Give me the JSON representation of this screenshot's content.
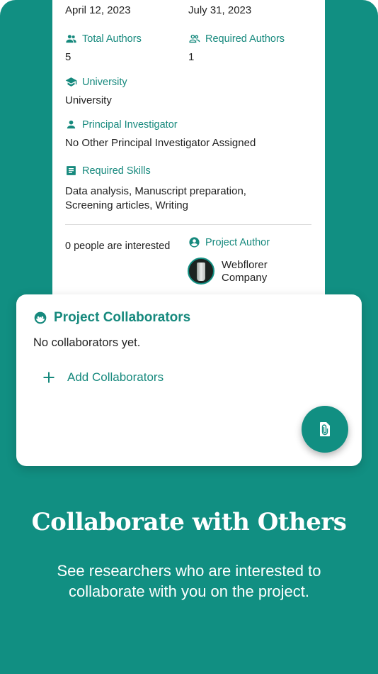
{
  "details": {
    "start_date": "April 12, 2023",
    "end_date": "July 31, 2023",
    "total_authors_label": "Total Authors",
    "total_authors_value": "5",
    "required_authors_label": "Required Authors",
    "required_authors_value": "1",
    "university_label": "University",
    "university_value": "University",
    "pi_label": "Principal Investigator",
    "pi_value": "No Other Principal Investigator Assigned",
    "skills_label": "Required Skills",
    "skills_value": "Data analysis, Manuscript preparation, Screening articles, Writing",
    "interested_text": "0 people are interested",
    "project_author_label": "Project Author",
    "author_name_line1": "Webflorer",
    "author_name_line2": "Company"
  },
  "collaborators": {
    "title": "Project Collaborators",
    "empty_text": "No collaborators yet.",
    "add_label": "Add Collaborators"
  },
  "promo": {
    "headline": "Collaborate with Others",
    "subtext": "See researchers who are interested to collaborate with you on the project."
  },
  "colors": {
    "accent": "#118f82",
    "label": "#16897d"
  },
  "icons": {
    "total_authors": "people-icon",
    "required_authors": "people-outline-icon",
    "university": "graduation-cap-icon",
    "principal_investigator": "person-icon",
    "required_skills": "list-icon",
    "project_author": "account-circle-icon",
    "collaborators": "face-icon",
    "add": "plus-icon",
    "fab": "file-attachment-icon"
  }
}
